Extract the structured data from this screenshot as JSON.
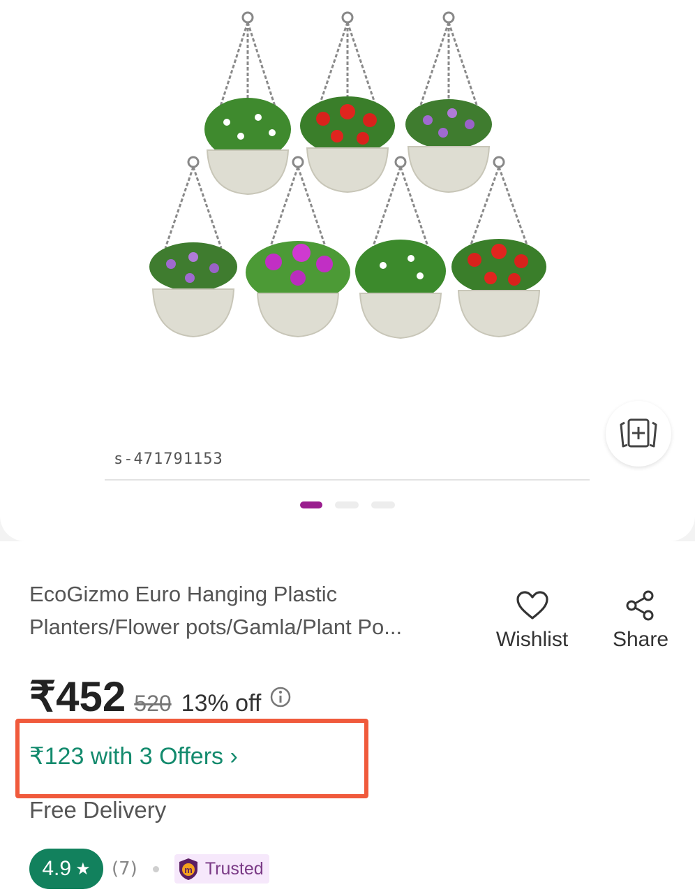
{
  "gallery": {
    "sku": "s-471791153",
    "dots_count": 3,
    "active_dot": 0,
    "similar_icon": "view-similar-icon"
  },
  "product": {
    "title_line1": "EcoGizmo Euro Hanging Plastic",
    "title_line2": "Planters/Flower pots/Gamla/Plant Po..."
  },
  "actions": {
    "wishlist_label": "Wishlist",
    "wishlist_icon": "heart-icon",
    "share_label": "Share",
    "share_icon": "share-icon"
  },
  "pricing": {
    "price": "₹452",
    "mrp": "520",
    "discount": "13% off",
    "info_icon": "info-icon",
    "offers_text": "₹123 with 3 Offers ›",
    "delivery": "Free Delivery"
  },
  "rating": {
    "value": "4.9",
    "star": "★",
    "count": "(7)",
    "trusted_label": "Trusted",
    "trusted_icon": "m-shield-icon"
  },
  "colors": {
    "accent": "#9a1d8e",
    "offer_green": "#138a6d",
    "rating_green": "#12815d",
    "highlight": "#f05a3c"
  }
}
